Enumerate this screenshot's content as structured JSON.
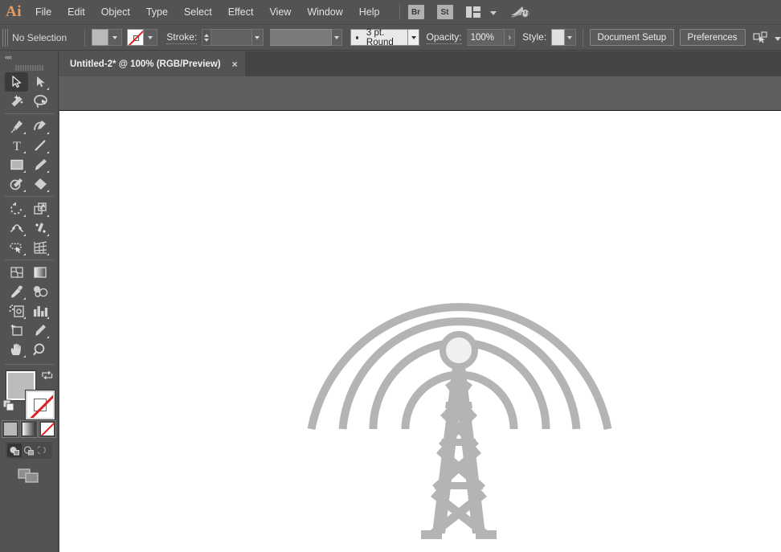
{
  "app": {
    "logo": "Ai",
    "name": "Adobe Illustrator"
  },
  "menubar": {
    "items": [
      {
        "label": "File"
      },
      {
        "label": "Edit"
      },
      {
        "label": "Object"
      },
      {
        "label": "Type"
      },
      {
        "label": "Select"
      },
      {
        "label": "Effect"
      },
      {
        "label": "View"
      },
      {
        "label": "Window"
      },
      {
        "label": "Help"
      }
    ],
    "bridge_button": "Br",
    "stock_button": "St",
    "arrange_icon": "arrange-documents-icon",
    "arrange_chevron": "chevron-down-icon",
    "rocket_icon": "start-workspace-icon"
  },
  "controlbar": {
    "grip": "panel-grip",
    "selection_status": "No Selection",
    "fill_swatch": {
      "name": "fill-color-swatch",
      "color": "#bcbcbc"
    },
    "stroke_swatch": {
      "name": "stroke-color-swatch",
      "color": "none"
    },
    "stroke_label": "Stroke:",
    "stroke_weight": "",
    "stroke_profile": "",
    "brush_definition": "3 pt. Round",
    "opacity_label": "Opacity:",
    "opacity_value": "100%",
    "style_label": "Style:",
    "style_swatch_color": "#e0e0e0",
    "document_setup_button": "Document Setup",
    "preferences_button": "Preferences",
    "select_similar_icon": "select-similar-objects-icon"
  },
  "tabbar": {
    "tab": {
      "title": "Untitled-2* @ 100% (RGB/Preview)",
      "close": "×"
    }
  },
  "toolpanel": {
    "collapse": "««",
    "tools": [
      {
        "name": "selection-tool",
        "active": true,
        "corner": false
      },
      {
        "name": "direct-selection-tool",
        "active": false,
        "corner": true
      },
      {
        "name": "magic-wand-tool",
        "active": false,
        "corner": false
      },
      {
        "name": "lasso-tool",
        "active": false,
        "corner": false
      },
      {
        "name": "pen-tool",
        "active": false,
        "corner": true
      },
      {
        "name": "curvature-tool",
        "active": false,
        "corner": true
      },
      {
        "name": "type-tool",
        "active": false,
        "corner": true
      },
      {
        "name": "line-segment-tool",
        "active": false,
        "corner": true
      },
      {
        "name": "rectangle-tool",
        "active": false,
        "corner": true
      },
      {
        "name": "paintbrush-tool",
        "active": false,
        "corner": true
      },
      {
        "name": "shaper-tool",
        "active": false,
        "corner": true
      },
      {
        "name": "eraser-tool",
        "active": false,
        "corner": true
      },
      {
        "name": "rotate-tool",
        "active": false,
        "corner": true
      },
      {
        "name": "scale-tool",
        "active": false,
        "corner": true
      },
      {
        "name": "width-tool",
        "active": false,
        "corner": true
      },
      {
        "name": "free-transform-tool",
        "active": false,
        "corner": true
      },
      {
        "name": "shape-builder-tool",
        "active": false,
        "corner": true
      },
      {
        "name": "perspective-grid-tool",
        "active": false,
        "corner": true
      },
      {
        "name": "mesh-tool",
        "active": false,
        "corner": false
      },
      {
        "name": "gradient-tool",
        "active": false,
        "corner": false
      },
      {
        "name": "eyedropper-tool",
        "active": false,
        "corner": true
      },
      {
        "name": "blend-tool",
        "active": false,
        "corner": false
      },
      {
        "name": "symbol-sprayer-tool",
        "active": false,
        "corner": true
      },
      {
        "name": "column-graph-tool",
        "active": false,
        "corner": true
      },
      {
        "name": "artboard-tool",
        "active": false,
        "corner": false
      },
      {
        "name": "slice-tool",
        "active": false,
        "corner": true
      },
      {
        "name": "hand-tool",
        "active": false,
        "corner": true
      },
      {
        "name": "zoom-tool",
        "active": false,
        "corner": false
      }
    ],
    "fill_color": "#bcbcbc",
    "stroke_color": "none",
    "swap_icon": "swap-fill-stroke-icon",
    "default_icon": "default-fill-stroke-icon",
    "color_modes": [
      {
        "name": "color-mode-button",
        "active": true
      },
      {
        "name": "gradient-mode-button",
        "active": false
      },
      {
        "name": "none-mode-button",
        "active": false
      }
    ],
    "draw_modes": [
      {
        "name": "draw-normal-button",
        "active": true
      },
      {
        "name": "draw-behind-button",
        "active": false
      },
      {
        "name": "draw-inside-button",
        "active": false
      }
    ],
    "screen_mode_icon": "change-screen-mode-icon"
  },
  "artwork": {
    "name": "radio-tower-illustration",
    "description": "Broadcast / radio tower with four concentric signal arcs",
    "shape_color": "#b4b4b4",
    "dome_color": "#f0f0f0",
    "arc_count": 4,
    "arc_stroke_width": 10
  }
}
